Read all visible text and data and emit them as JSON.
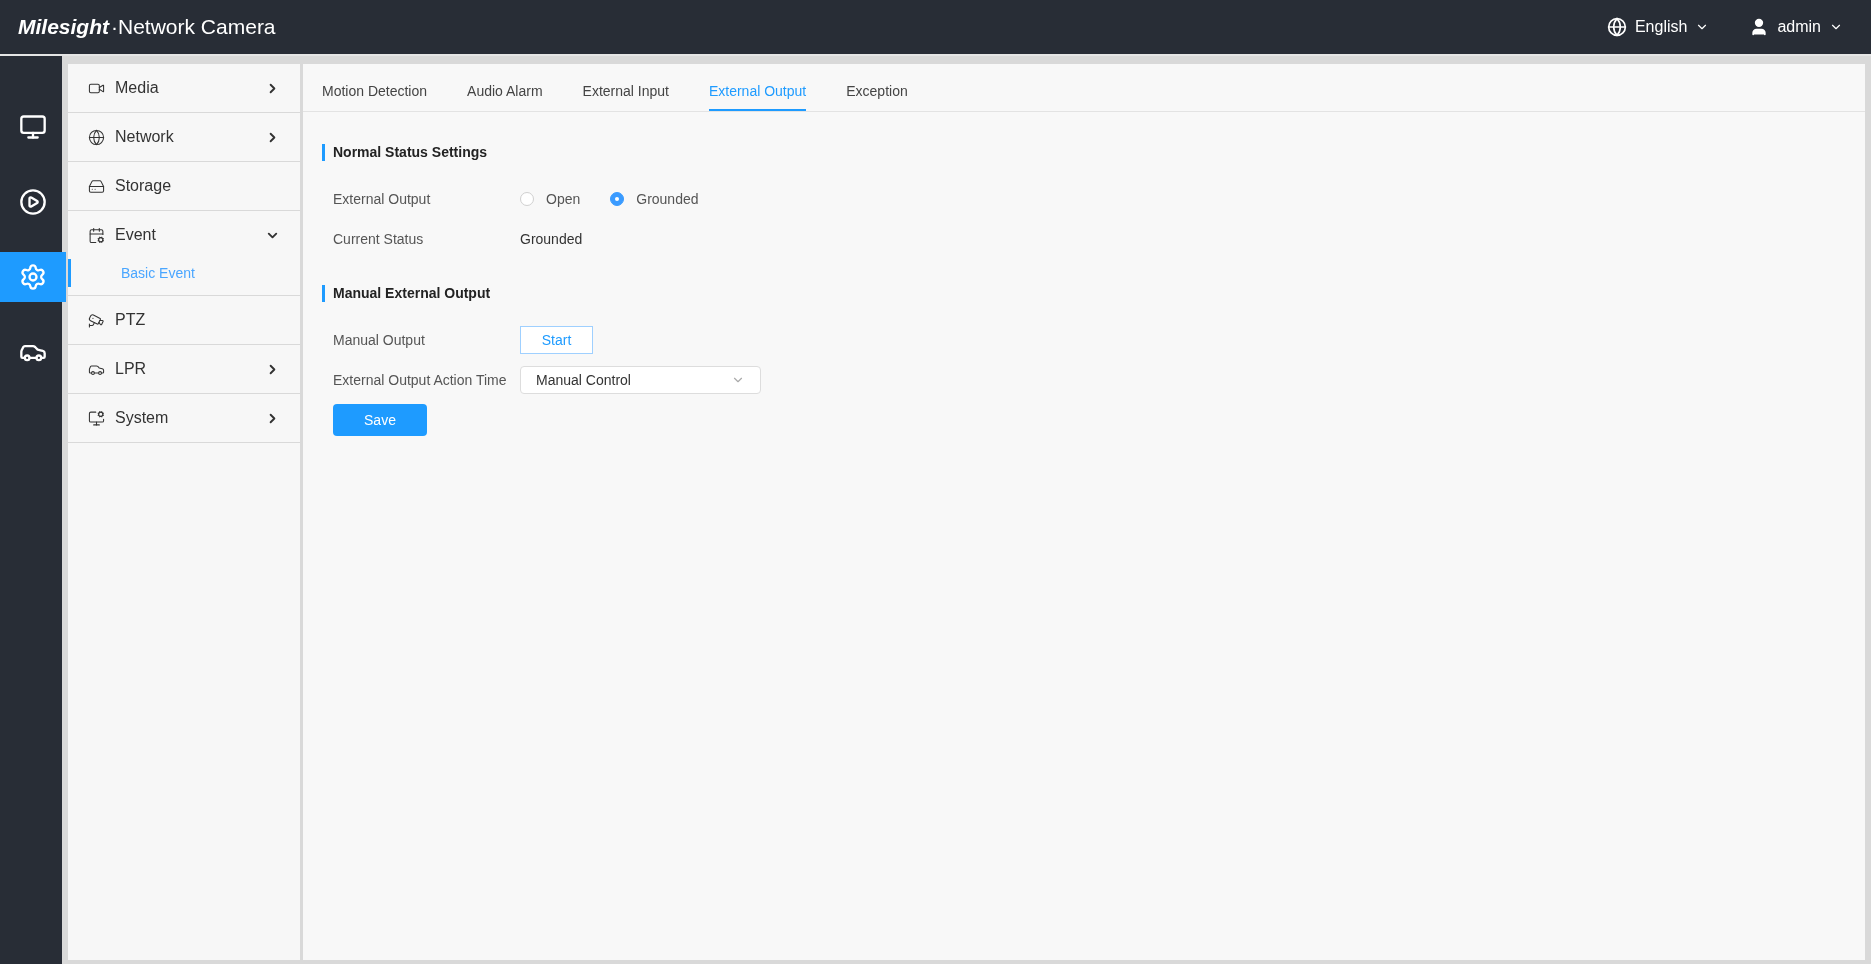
{
  "header": {
    "brand": "Milesight",
    "product": "·Network Camera",
    "language": "English",
    "user": "admin"
  },
  "rail": [
    {
      "kind": "live",
      "selected": false
    },
    {
      "kind": "playback",
      "selected": false
    },
    {
      "kind": "settings",
      "selected": true
    },
    {
      "kind": "vehicle",
      "selected": false
    }
  ],
  "menu": [
    {
      "label": "Media",
      "kind": "media",
      "expanded": false,
      "has_arrow": true
    },
    {
      "label": "Network",
      "kind": "network",
      "expanded": false,
      "has_arrow": true
    },
    {
      "label": "Storage",
      "kind": "storage",
      "has_arrow": false
    },
    {
      "label": "Event",
      "kind": "event",
      "expanded": true,
      "has_arrow": true,
      "children": [
        {
          "label": "Basic Event",
          "selected": true
        }
      ]
    },
    {
      "label": "PTZ",
      "kind": "ptz",
      "has_arrow": false
    },
    {
      "label": "LPR",
      "kind": "lpr",
      "expanded": false,
      "has_arrow": true
    },
    {
      "label": "System",
      "kind": "system",
      "expanded": false,
      "has_arrow": true
    }
  ],
  "tabs": [
    {
      "label": "Motion Detection",
      "selected": false
    },
    {
      "label": "Audio Alarm",
      "selected": false
    },
    {
      "label": "External Input",
      "selected": false
    },
    {
      "label": "External Output",
      "selected": true
    },
    {
      "label": "Exception",
      "selected": false
    }
  ],
  "sections": [
    {
      "title": "Normal Status Settings",
      "rows": [
        {
          "kind": "radio",
          "label": "External Output",
          "options": [
            {
              "label": "Open",
              "selected": false
            },
            {
              "label": "Grounded",
              "selected": true
            }
          ]
        },
        {
          "kind": "text",
          "label": "Current Status",
          "value": "Grounded"
        }
      ]
    },
    {
      "title": "Manual External Output",
      "rows": [
        {
          "kind": "button",
          "label": "Manual Output",
          "value": "Start"
        },
        {
          "kind": "select",
          "label": "External Output Action Time",
          "value": "Manual Control"
        }
      ]
    }
  ],
  "save_button": "Save"
}
